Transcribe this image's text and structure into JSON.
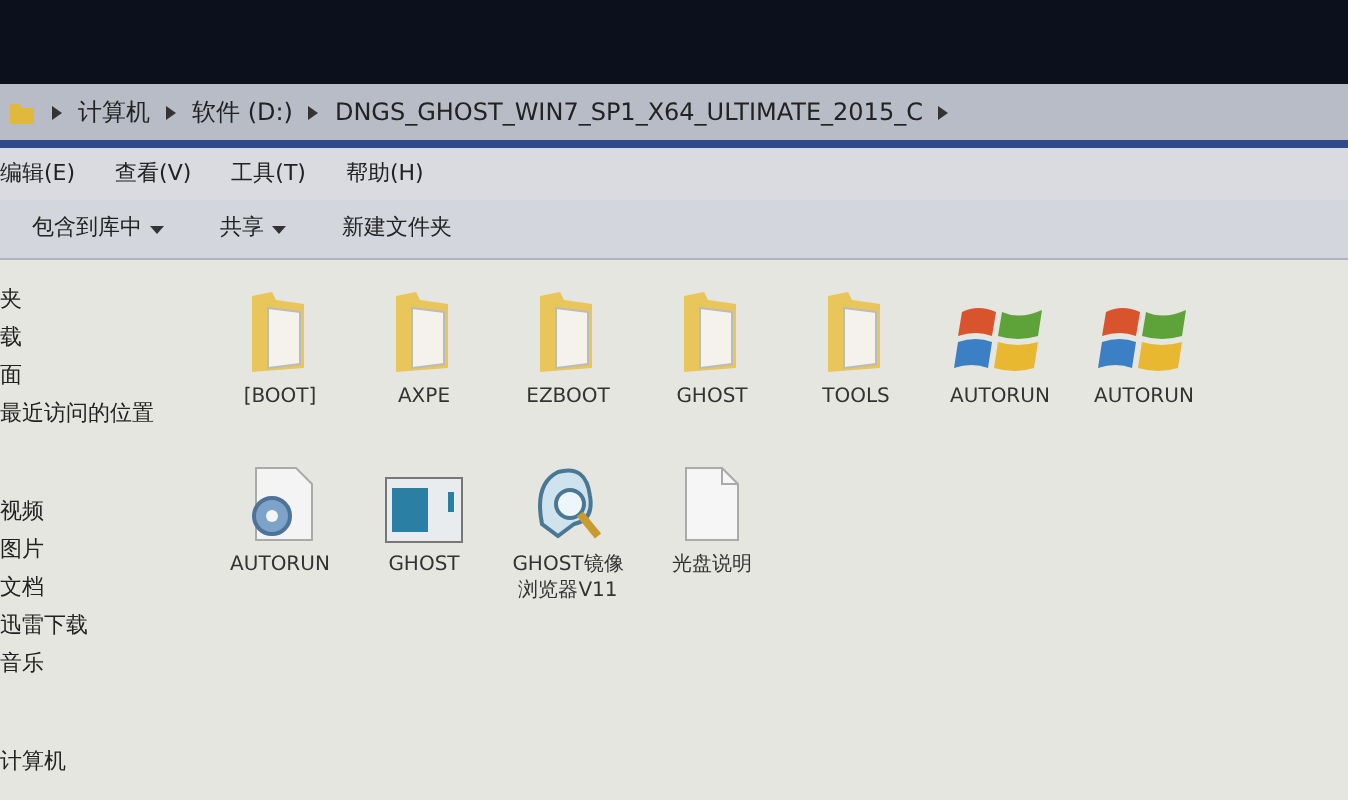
{
  "address_bar": {
    "crumbs": [
      "计算机",
      "软件 (D:)",
      "DNGS_GHOST_WIN7_SP1_X64_ULTIMATE_2015_C"
    ]
  },
  "menu_bar": [
    "编辑(E)",
    "查看(V)",
    "工具(T)",
    "帮助(H)"
  ],
  "toolbar": [
    {
      "label": "包含到库中",
      "dropdown": true
    },
    {
      "label": "共享",
      "dropdown": true
    },
    {
      "label": "新建文件夹",
      "dropdown": false
    }
  ],
  "sidebar": {
    "items": [
      "夹",
      "载",
      "面",
      "最近访问的位置",
      "视频",
      "图片",
      "文档",
      "迅雷下载",
      "音乐",
      "计算机"
    ]
  },
  "files": [
    {
      "name": "[BOOT]",
      "kind": "folder"
    },
    {
      "name": "AXPE",
      "kind": "folder"
    },
    {
      "name": "EZBOOT",
      "kind": "folder"
    },
    {
      "name": "GHOST",
      "kind": "folder"
    },
    {
      "name": "TOOLS",
      "kind": "folder"
    },
    {
      "name": "AUTORUN",
      "kind": "windows"
    },
    {
      "name": "AUTORUN",
      "kind": "windows"
    },
    {
      "name": "AUTORUN",
      "kind": "settings"
    },
    {
      "name": "GHOST",
      "kind": "app"
    },
    {
      "name": "GHOST镜像浏览器V11",
      "kind": "ghost"
    },
    {
      "name": "光盘说明",
      "kind": "document"
    }
  ]
}
